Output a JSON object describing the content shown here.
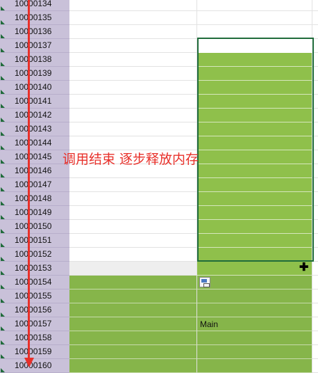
{
  "rows": [
    {
      "num": "10000134",
      "a": "white",
      "b": "white"
    },
    {
      "num": "10000135",
      "a": "white",
      "b": "white"
    },
    {
      "num": "10000136",
      "a": "white",
      "b": "white"
    },
    {
      "num": "10000137",
      "a": "white",
      "b": "white"
    },
    {
      "num": "10000138",
      "a": "white",
      "b": "green"
    },
    {
      "num": "10000139",
      "a": "white",
      "b": "green"
    },
    {
      "num": "10000140",
      "a": "white",
      "b": "green"
    },
    {
      "num": "10000141",
      "a": "white",
      "b": "green"
    },
    {
      "num": "10000142",
      "a": "white",
      "b": "green"
    },
    {
      "num": "10000143",
      "a": "white",
      "b": "green"
    },
    {
      "num": "10000144",
      "a": "white",
      "b": "green"
    },
    {
      "num": "10000145",
      "a": "white",
      "b": "green"
    },
    {
      "num": "10000146",
      "a": "white",
      "b": "green"
    },
    {
      "num": "10000147",
      "a": "white",
      "b": "green"
    },
    {
      "num": "10000148",
      "a": "white",
      "b": "green"
    },
    {
      "num": "10000149",
      "a": "white",
      "b": "green"
    },
    {
      "num": "10000150",
      "a": "white",
      "b": "green"
    },
    {
      "num": "10000151",
      "a": "white",
      "b": "green"
    },
    {
      "num": "10000152",
      "a": "white",
      "b": "green"
    },
    {
      "num": "10000153",
      "a": "grey",
      "b": "green"
    },
    {
      "num": "10000154",
      "a": "green2",
      "b": "green2"
    },
    {
      "num": "10000155",
      "a": "green2",
      "b": "green2"
    },
    {
      "num": "10000156",
      "a": "green2",
      "b": "green2"
    },
    {
      "num": "10000157",
      "a": "green2",
      "b": "green2"
    },
    {
      "num": "10000158",
      "a": "green2",
      "b": "green2"
    },
    {
      "num": "10000159",
      "a": "green2",
      "b": "green2"
    },
    {
      "num": "10000160",
      "a": "green2",
      "b": "green2"
    }
  ],
  "annotation": "调用结束 逐步释放内存",
  "cell_text": {
    "main": "Main"
  },
  "icons": {
    "cursor": "crosshair-plus-icon",
    "paste": "paste-options-icon"
  },
  "colors": {
    "fill_green": "#8fc04b",
    "fill_green_dark": "#86b54a",
    "selection_border": "#1f6b3a",
    "arrow": "#e8302a",
    "row_header": "#c9c1d9"
  }
}
